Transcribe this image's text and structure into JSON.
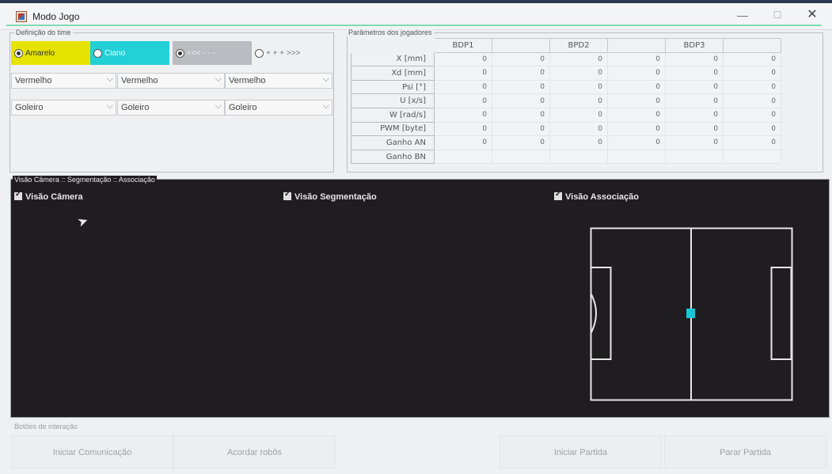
{
  "window": {
    "title": "Modo Jogo",
    "controls": {
      "minimize": "—",
      "maximize": "☐",
      "close": "✕"
    }
  },
  "team": {
    "legend": "Definição do time",
    "radios": [
      {
        "label": "Amarelo",
        "selected": true,
        "color": "#e5e300"
      },
      {
        "label": "Ciano",
        "selected": false,
        "color": "#22d1d6"
      },
      {
        "label": "<<< - - -",
        "selected": true,
        "color": "#b9bcc0"
      },
      {
        "label": "+ + + >>>",
        "selected": false,
        "color": ""
      }
    ],
    "color_combos": [
      "Vermelho",
      "Vermelho",
      "Vermelho"
    ],
    "role_combos": [
      "Goleiro",
      "Goleiro",
      "Goleiro"
    ]
  },
  "params": {
    "legend": "Parâmetros dos jogadores",
    "headers": [
      "BDP1",
      "",
      "BPD2",
      "",
      "BDP3",
      ""
    ],
    "rows": [
      {
        "label": "X [mm]",
        "values": [
          "0",
          "0",
          "0",
          "0",
          "0",
          "0"
        ]
      },
      {
        "label": "Xd [mm]",
        "values": [
          "0",
          "0",
          "0",
          "0",
          "0",
          "0"
        ]
      },
      {
        "label": "Psi [°]",
        "values": [
          "0",
          "0",
          "0",
          "0",
          "0",
          "0"
        ]
      },
      {
        "label": "U [x/s]",
        "values": [
          "0",
          "0",
          "0",
          "0",
          "0",
          "0"
        ]
      },
      {
        "label": "W [rad/s]",
        "values": [
          "0",
          "0",
          "0",
          "0",
          "0",
          "0"
        ]
      },
      {
        "label": "PWM [byte]",
        "values": [
          "0",
          "0",
          "0",
          "0",
          "0",
          "0"
        ]
      },
      {
        "label": "Ganho AN",
        "values": [
          "0",
          "0",
          "0",
          "0",
          "0",
          "0"
        ]
      },
      {
        "label": "Ganho BN",
        "values": [
          "",
          "",
          "",
          "",
          "",
          ""
        ]
      }
    ]
  },
  "camera": {
    "legend": "Visão Câmera :: Segmentação :: Associação",
    "checkboxes": {
      "camera": "Visão Câmera",
      "segmentation": "Visão Segmentação",
      "association": "Visão Associação"
    },
    "ball_color": "#19c6d6"
  },
  "buttons": {
    "legend": "Botões de interação",
    "start_comm": "Iniciar Comunicação",
    "wake_robots": "Acordar robôs",
    "start_match": "Iniciar Partida",
    "stop_match": "Parar Partida"
  }
}
